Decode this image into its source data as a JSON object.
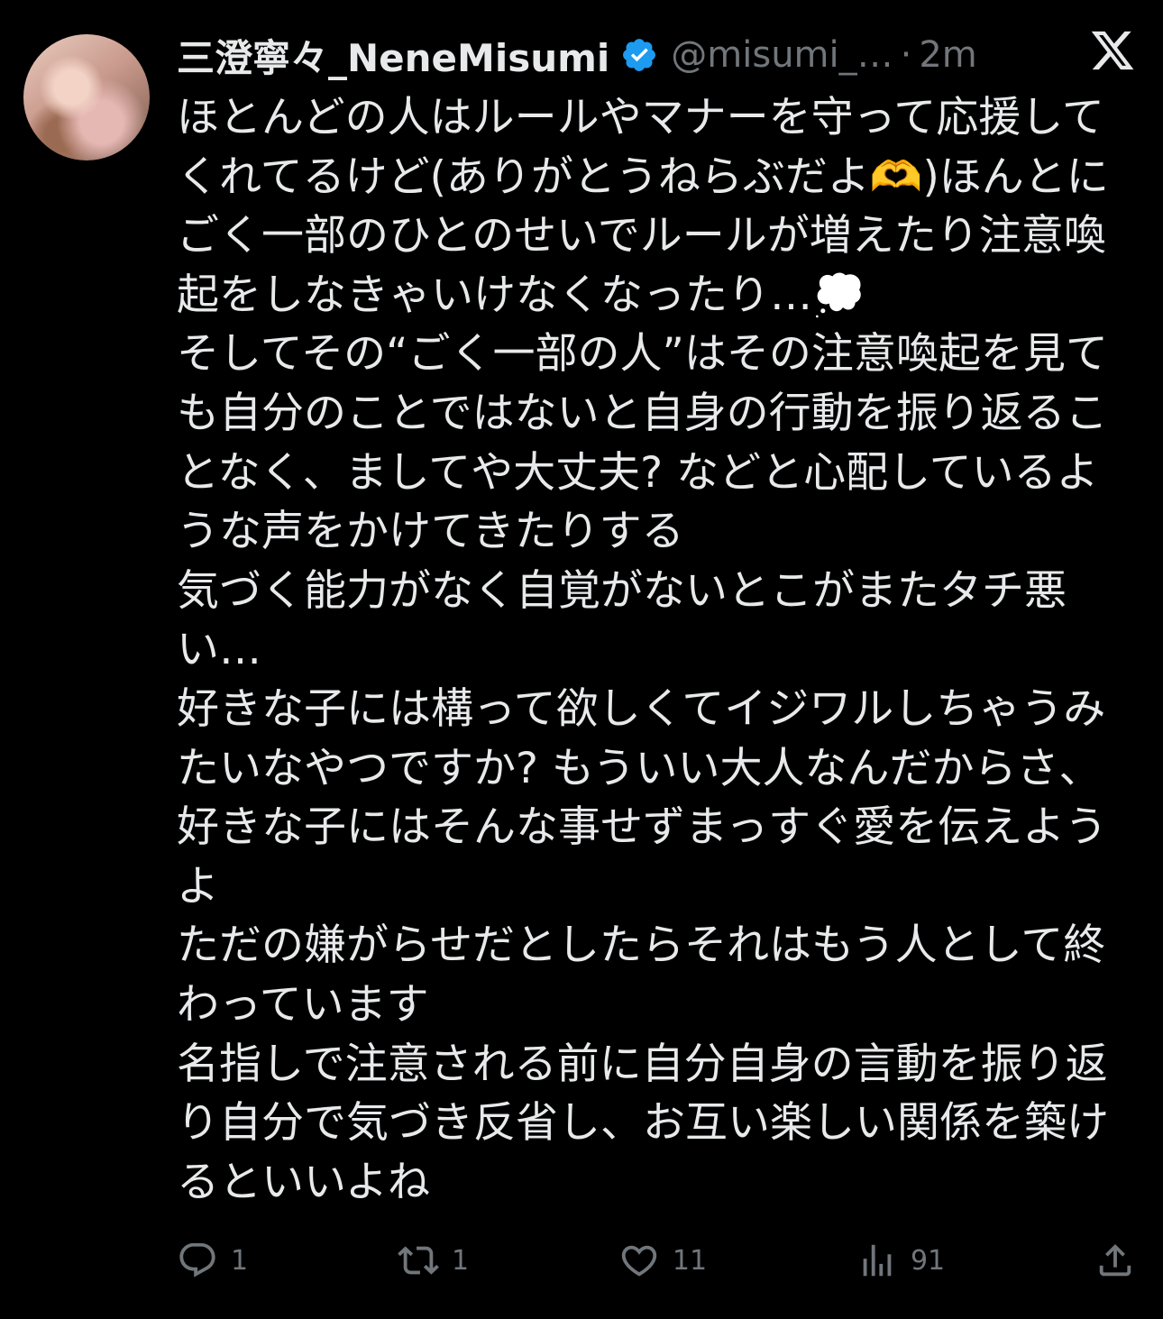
{
  "tweet": {
    "display_name": "三澄寧々_NeneMisumi",
    "handle": "@misumi_…",
    "separator": "·",
    "time": "2m",
    "text": "ほとんどの人はルールやマナーを守って応援して\nくれてるけど(ありがとうねらぶだよ🫶)ほんとに\nごく一部のひとのせいでルールが増えたり注意喚\n起をしなきゃいけなくなったり…💭\nそしてその“ごく一部の人”はその注意喚起を見て\nも自分のことではないと自身の行動を振り返るこ\nとなく、ましてや大丈夫? などと心配しているよ\nうな声をかけてきたりする\n気づく能力がなく自覚がないとこがまたタチ悪\nい…\n好きな子には構って欲しくてイジワルしちゃうみ\nたいなやつですか? もういい大人なんだからさ、\n好きな子にはそんな事せずまっすぐ愛を伝えよう\nよ\nただの嫌がらせだとしたらそれはもう人として終\nわっています\n名指しで注意される前に自分自身の言動を振り返\nり自分で気づき反省し、お互い楽しい関係を築け\nるといいよね"
  },
  "actions": {
    "replies": "1",
    "retweets": "1",
    "likes": "11",
    "views": "91"
  },
  "icons": {
    "verified": "verified-badge-icon",
    "logo": "x-logo-icon",
    "reply": "reply-icon",
    "retweet": "retweet-icon",
    "like": "heart-icon",
    "views": "views-icon",
    "share": "share-icon"
  },
  "colors": {
    "background": "#000000",
    "text": "#e7e9ea",
    "muted": "#71767b",
    "verified": "#1d9bf0"
  }
}
